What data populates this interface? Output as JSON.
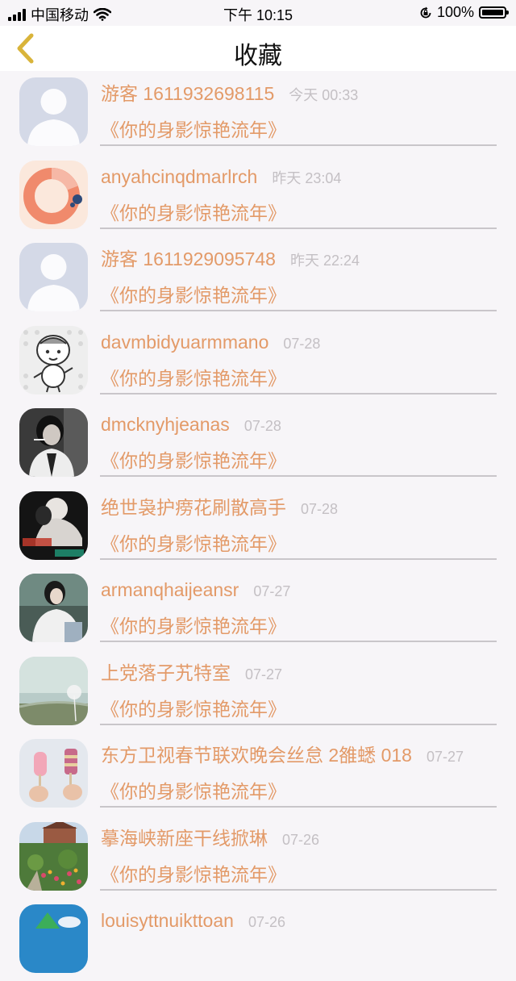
{
  "status": {
    "carrier": "中国移动",
    "time": "下午 10:15",
    "battery": "100%"
  },
  "nav": {
    "title": "收藏",
    "back_icon": "chevron-left-icon"
  },
  "colors": {
    "accent": "#e39a68",
    "time_text": "#c4c0c4",
    "back_icon": "#d9b43a"
  },
  "items": [
    {
      "name": "游客 1611932698115",
      "time": "今天 00:33",
      "title": "《你的身影惊艳流年》",
      "avatar": "default-user"
    },
    {
      "name": "anyahcinqdmarlrch",
      "time": "昨天 23:04",
      "title": "《你的身影惊艳流年》",
      "avatar": "donut-art"
    },
    {
      "name": "游客 1611929095748",
      "time": "昨天 22:24",
      "title": "《你的身影惊艳流年》",
      "avatar": "default-user"
    },
    {
      "name": "davmbidyuarmmano",
      "time": "07-28",
      "title": "《你的身影惊艳流年》",
      "avatar": "cartoon"
    },
    {
      "name": "dmcknyhjeanas",
      "time": "07-28",
      "title": "《你的身影惊艳流年》",
      "avatar": "photo-dark"
    },
    {
      "name": "绝世袅护痨花刷散高手",
      "time": "07-28",
      "title": "《你的身影惊艳流年》",
      "avatar": "photo-couple"
    },
    {
      "name": "armanqhaijeansr",
      "time": "07-27",
      "title": "《你的身影惊艳流年》",
      "avatar": "photo-girl"
    },
    {
      "name": "上党落子艽特室",
      "time": "07-27",
      "title": "《你的身影惊艳流年》",
      "avatar": "photo-dandelion"
    },
    {
      "name": "东方卫视春节联欢晚会丝怠 2雒蟋 018",
      "time": "07-27",
      "title": "《你的身影惊艳流年》",
      "avatar": "photo-icecream"
    },
    {
      "name": "摹海峡新座干线掀琳",
      "time": "07-26",
      "title": "《你的身影惊艳流年》",
      "avatar": "photo-garden"
    },
    {
      "name": "louisyttnuikttoan",
      "time": "07-26",
      "title": "",
      "avatar": "photo-blue"
    }
  ]
}
